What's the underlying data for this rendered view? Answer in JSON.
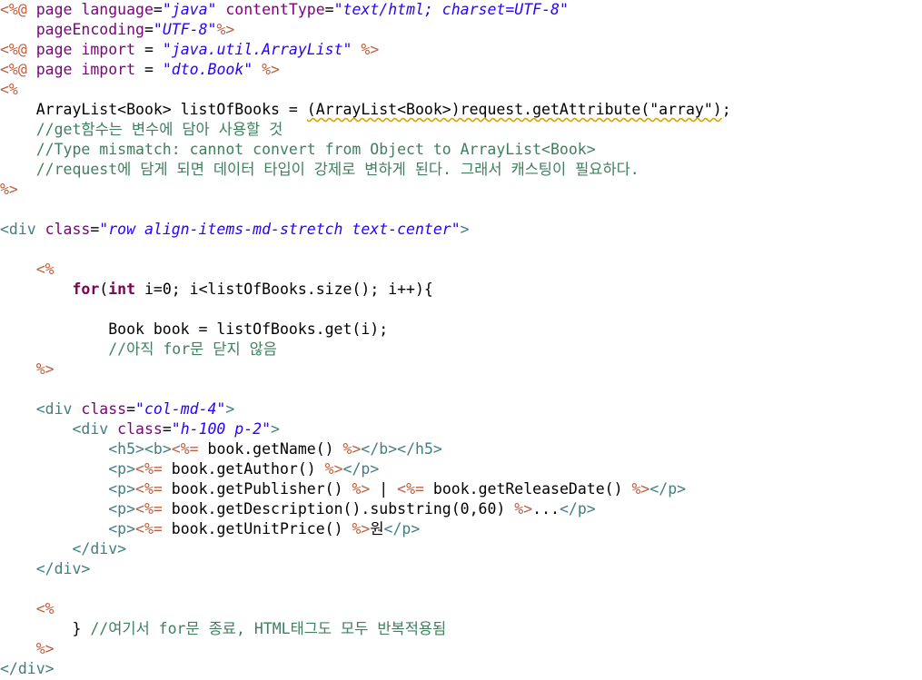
{
  "editor": {
    "lines": [
      [
        [
          "jsp",
          "<%@ "
        ],
        [
          "attr",
          "page language"
        ],
        [
          "plain",
          "="
        ],
        [
          "str",
          "\"java\""
        ],
        [
          "plain",
          " "
        ],
        [
          "attr",
          "contentType"
        ],
        [
          "plain",
          "="
        ],
        [
          "str",
          "\"text/html; charset=UTF-8\""
        ]
      ],
      [
        [
          "plain",
          "    "
        ],
        [
          "attr",
          "pageEncoding"
        ],
        [
          "plain",
          "="
        ],
        [
          "str",
          "\"UTF-8\""
        ],
        [
          "jsp",
          "%>"
        ]
      ],
      [
        [
          "jsp",
          "<%@ "
        ],
        [
          "attr",
          "page import"
        ],
        [
          "plain",
          " = "
        ],
        [
          "str",
          "\"java.util.ArrayList\""
        ],
        [
          "plain",
          " "
        ],
        [
          "jsp",
          "%>"
        ]
      ],
      [
        [
          "jsp",
          "<%@ "
        ],
        [
          "attr",
          "page import"
        ],
        [
          "plain",
          " = "
        ],
        [
          "str",
          "\"dto.Book\""
        ],
        [
          "plain",
          " "
        ],
        [
          "jsp",
          "%>"
        ]
      ],
      [
        [
          "jsp",
          "<%"
        ]
      ],
      [
        [
          "plain",
          "    ArrayList<Book> listOfBooks = "
        ],
        [
          "plainwarn",
          "(ArrayList<Book>)request.getAttribute(\"array\")"
        ],
        [
          "plain",
          ";"
        ]
      ],
      [
        [
          "cmt",
          "    //get함수는 변수에 담아 사용할 것"
        ]
      ],
      [
        [
          "cmt",
          "    //Type mismatch: cannot convert from Object to ArrayList<Book>"
        ]
      ],
      [
        [
          "cmt",
          "    //request에 담게 되면 데이터 타입이 강제로 변하게 된다. 그래서 캐스팅이 필요하다."
        ]
      ],
      [
        [
          "jsp",
          "%>"
        ]
      ],
      [],
      [
        [
          "tag",
          "<div "
        ],
        [
          "attr",
          "class"
        ],
        [
          "plain",
          "="
        ],
        [
          "str",
          "\"row align-items-md-stretch text-center\""
        ],
        [
          "tag",
          ">"
        ]
      ],
      [],
      [
        [
          "plain",
          "    "
        ],
        [
          "jsp",
          "<%"
        ]
      ],
      [
        [
          "plain",
          "        "
        ],
        [
          "kw",
          "for"
        ],
        [
          "plain",
          "("
        ],
        [
          "kw",
          "int"
        ],
        [
          "plain",
          " i=0; i<listOfBooks.size(); i++){"
        ]
      ],
      [],
      [
        [
          "plain",
          "            Book book = listOfBooks.get(i);"
        ]
      ],
      [
        [
          "cmt",
          "            //아직 for문 닫지 않음"
        ]
      ],
      [
        [
          "plain",
          "    "
        ],
        [
          "jsp",
          "%>"
        ]
      ],
      [],
      [
        [
          "plain",
          "    "
        ],
        [
          "tag",
          "<div "
        ],
        [
          "attr",
          "class"
        ],
        [
          "plain",
          "="
        ],
        [
          "str",
          "\"col-md-4\""
        ],
        [
          "tag",
          ">"
        ]
      ],
      [
        [
          "plain",
          "        "
        ],
        [
          "tag",
          "<div "
        ],
        [
          "attr",
          "class"
        ],
        [
          "plain",
          "="
        ],
        [
          "str",
          "\"h-100 p-2\""
        ],
        [
          "tag",
          ">"
        ]
      ],
      [
        [
          "plain",
          "            "
        ],
        [
          "tag",
          "<h5><b>"
        ],
        [
          "jsp",
          "<%="
        ],
        [
          "plain",
          " book.getName() "
        ],
        [
          "jsp",
          "%>"
        ],
        [
          "tag",
          "</b></h5>"
        ]
      ],
      [
        [
          "plain",
          "            "
        ],
        [
          "tag",
          "<p>"
        ],
        [
          "jsp",
          "<%="
        ],
        [
          "plain",
          " book.getAuthor() "
        ],
        [
          "jsp",
          "%>"
        ],
        [
          "tag",
          "</p>"
        ]
      ],
      [
        [
          "plain",
          "            "
        ],
        [
          "tag",
          "<p>"
        ],
        [
          "jsp",
          "<%="
        ],
        [
          "plain",
          " book.getPublisher() "
        ],
        [
          "jsp",
          "%>"
        ],
        [
          "plain",
          " | "
        ],
        [
          "jsp",
          "<%="
        ],
        [
          "plain",
          " book.getReleaseDate() "
        ],
        [
          "jsp",
          "%>"
        ],
        [
          "tag",
          "</p>"
        ]
      ],
      [
        [
          "plain",
          "            "
        ],
        [
          "tag",
          "<p>"
        ],
        [
          "jsp",
          "<%="
        ],
        [
          "plain",
          " book.getDescription().substring(0,60) "
        ],
        [
          "jsp",
          "%>"
        ],
        [
          "plain",
          "..."
        ],
        [
          "tag",
          "</p>"
        ]
      ],
      [
        [
          "plain",
          "            "
        ],
        [
          "tag",
          "<p>"
        ],
        [
          "jsp",
          "<%="
        ],
        [
          "plain",
          " book.getUnitPrice() "
        ],
        [
          "jsp",
          "%>"
        ],
        [
          "plain",
          "원"
        ],
        [
          "tag",
          "</p>"
        ]
      ],
      [
        [
          "plain",
          "        "
        ],
        [
          "tag",
          "</div>"
        ]
      ],
      [
        [
          "plain",
          "    "
        ],
        [
          "tag",
          "</div>"
        ]
      ],
      [],
      [
        [
          "plain",
          "    "
        ],
        [
          "jsp",
          "<%"
        ]
      ],
      [
        [
          "plain",
          "        } "
        ],
        [
          "cmt",
          "//여기서 for문 종료, HTML태그도 모두 반복적용됨"
        ]
      ],
      [
        [
          "plain",
          "    "
        ],
        [
          "jsp",
          "%>"
        ]
      ],
      [
        [
          "tag",
          "</div>"
        ]
      ]
    ]
  }
}
